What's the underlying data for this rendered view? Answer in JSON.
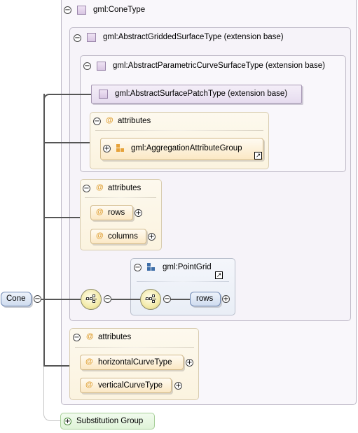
{
  "diagram": {
    "cone_type": "gml:ConeType",
    "abstract_gridded": "gml:AbstractGriddedSurfaceType (extension base)",
    "abstract_parametric": "gml:AbstractParametricCurveSurfaceType (extension base)",
    "abstract_patch": "gml:AbstractSurfacePatchType (extension base)",
    "attributes_label": "attributes",
    "aggregation_group": "gml:AggregationAttributeGroup",
    "rows": "rows",
    "columns": "columns",
    "point_grid": "gml:PointGrid",
    "rows_element": "rows",
    "horizontal_curve_type": "horizontalCurveType",
    "vertical_curve_type": "verticalCurveType",
    "root": "Cone",
    "substitution_group": "Substitution Group",
    "at_symbol": "@"
  },
  "colors": {
    "frame_border": "#bdb8c6",
    "attribute_bg": "#fbf3df",
    "element_bg": "#dde7f4",
    "substitution_bg": "#e4f7dd"
  }
}
